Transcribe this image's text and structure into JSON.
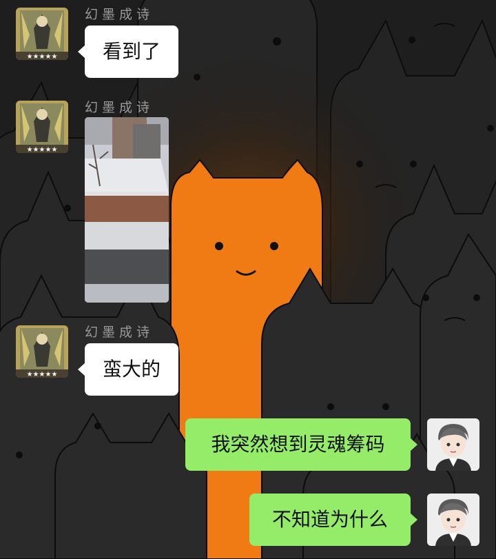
{
  "chat": {
    "messages": [
      {
        "sender": "幻墨成诗",
        "type": "text",
        "text": "看到了",
        "side": "incoming"
      },
      {
        "sender": "幻墨成诗",
        "type": "image",
        "image_alt": "snowy courtyard photo",
        "side": "incoming"
      },
      {
        "sender": "幻墨成诗",
        "type": "text",
        "text": "蛮大的",
        "side": "incoming"
      },
      {
        "type": "text",
        "text": "我突然想到灵魂筹码",
        "side": "outgoing"
      },
      {
        "type": "text",
        "text": "不知道为什么",
        "side": "outgoing"
      }
    ]
  },
  "colors": {
    "background": "#1e1e1e",
    "cat_dark": "#2b2b2b",
    "cat_orange": "#f07b14",
    "bubble_incoming": "#ffffff",
    "bubble_outgoing": "#95ec69",
    "sender_name": "#9a9a9a"
  },
  "icons": {
    "incoming_avatar": "anime-character-card-avatar",
    "outgoing_avatar": "cartoon-boy-avatar"
  }
}
